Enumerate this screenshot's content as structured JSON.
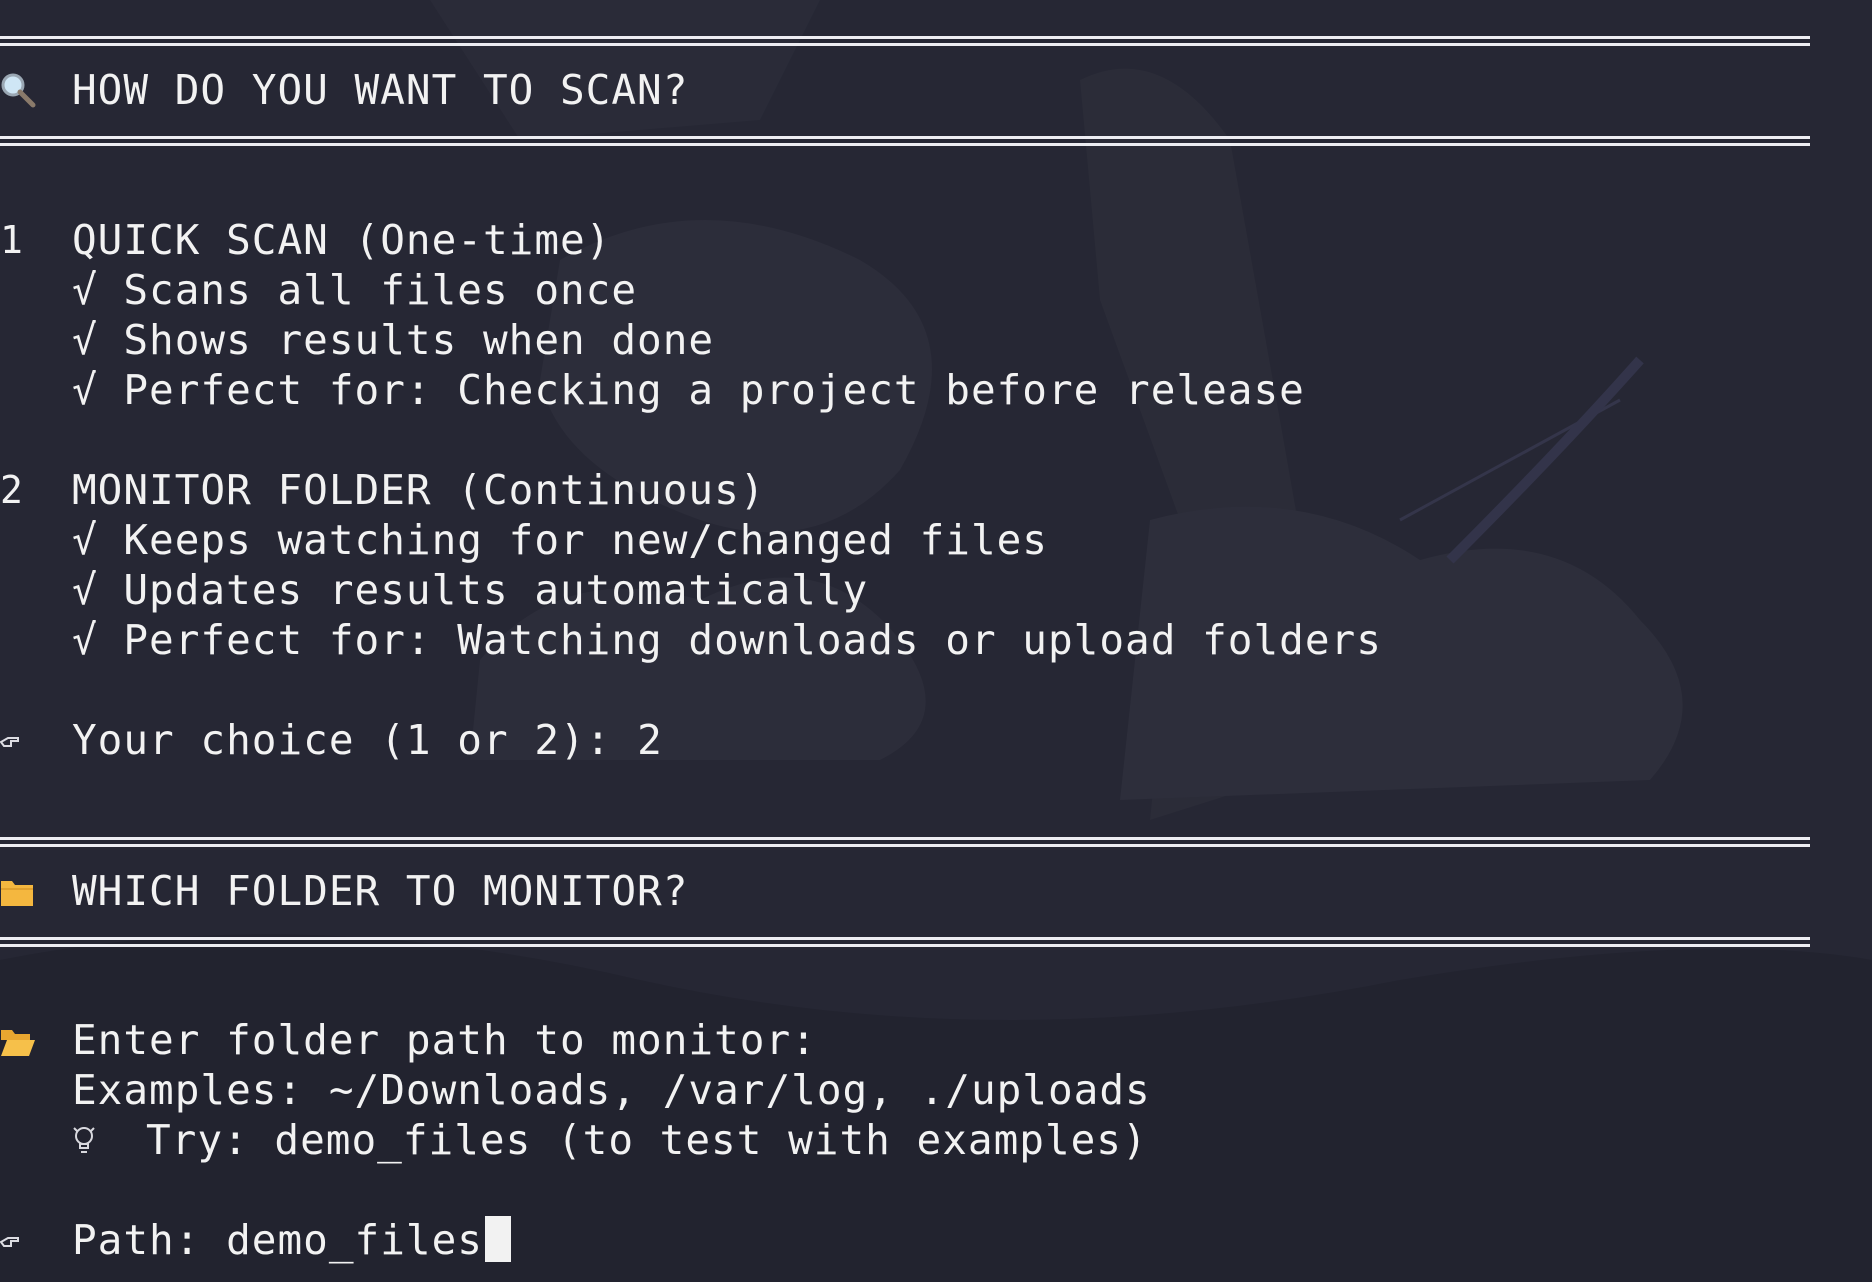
{
  "header1": {
    "title": "HOW DO YOU WANT TO SCAN?",
    "icon": "magnifier-icon"
  },
  "option1": {
    "number": "1",
    "title": "QUICK SCAN (One-time)",
    "bullets": [
      "√ Scans all files once",
      "√ Shows results when done",
      "√ Perfect for: Checking a project before release"
    ]
  },
  "option2": {
    "number": "2",
    "title": "MONITOR FOLDER (Continuous)",
    "bullets": [
      "√ Keeps watching for new/changed files",
      "√ Updates results automatically",
      "√ Perfect for: Watching downloads or upload folders"
    ]
  },
  "choice": {
    "prompt": "Your choice (1 or 2): ",
    "value": "2",
    "icon": "pointing-hand-icon"
  },
  "header2": {
    "title": "WHICH FOLDER TO MONITOR?",
    "icon": "folder-icon"
  },
  "folder_prompt": {
    "label": "Enter folder path to monitor:",
    "icon": "open-folder-icon",
    "examples": "Examples: ~/Downloads, /var/log, ./uploads",
    "tip": "Try: demo_files (to test with examples)",
    "tip_icon": "lightbulb-icon"
  },
  "path_input": {
    "prompt": "Path: ",
    "value": "demo_files",
    "icon": "pointing-hand-icon"
  },
  "colors": {
    "background": "#262734",
    "text": "#f2f2f2",
    "folder": "#f4b73f"
  }
}
